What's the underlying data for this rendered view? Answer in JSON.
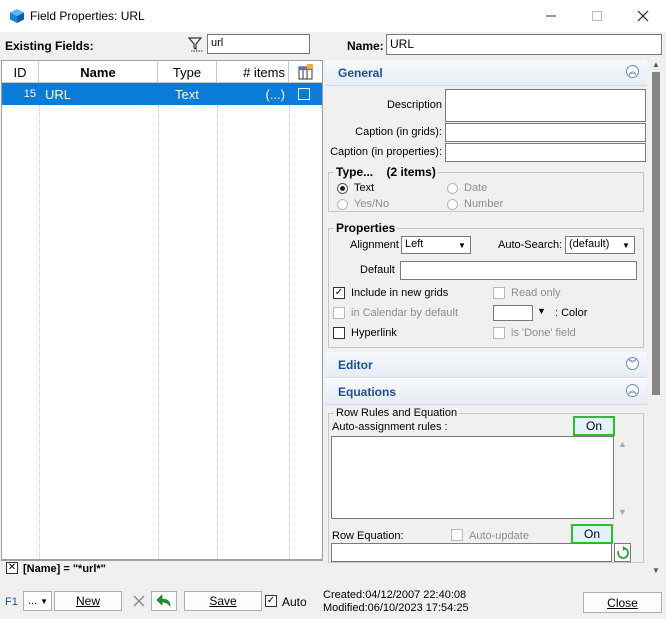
{
  "window": {
    "title": "Field Properties: URL"
  },
  "filter": {
    "label": "Existing Fields:",
    "value": "url"
  },
  "name_field": {
    "label": "Name:",
    "value": "URL"
  },
  "grid": {
    "columns": [
      "ID",
      "Name",
      "Type",
      "# items"
    ],
    "rows": [
      {
        "id": "15",
        "name": "URL",
        "type": "Text",
        "items": "(...)"
      }
    ],
    "filter_expression": "[Name] = \"*url*\""
  },
  "general": {
    "title": "General",
    "description_label": "Description",
    "caption_grids_label": "Caption (in grids):",
    "caption_props_label": "Caption (in properties):",
    "type_group_label": "Type...",
    "type_group_count": "(2 items)",
    "types": {
      "text": "Text",
      "date": "Date",
      "yesno": "Yes/No",
      "number": "Number"
    },
    "properties_label": "Properties",
    "alignment_label": "Alignment",
    "alignment_value": "Left",
    "autosearch_label": "Auto-Search:",
    "autosearch_value": "(default)",
    "default_label": "Default",
    "include_grids": "Include in new grids",
    "read_only": "Read only",
    "in_calendar": "in Calendar by default",
    "color_label": ": Color",
    "hyperlink": "Hyperlink",
    "is_done": "is 'Done' field"
  },
  "editor": {
    "title": "Editor"
  },
  "equations": {
    "title": "Equations",
    "group_label": "Row Rules and Equation",
    "auto_assign_label": "Auto-assignment rules :",
    "on_label": "On",
    "row_equation_label": "Row Equation:",
    "auto_update": "Auto-update",
    "on_label2": "On"
  },
  "footer": {
    "f1": "F1",
    "more": "...",
    "new": "New",
    "save": "Save",
    "auto": "Auto",
    "created": "Created:04/12/2007 22:40:08",
    "modified": "Modified:06/10/2023 17:54:25",
    "close": "Close"
  }
}
